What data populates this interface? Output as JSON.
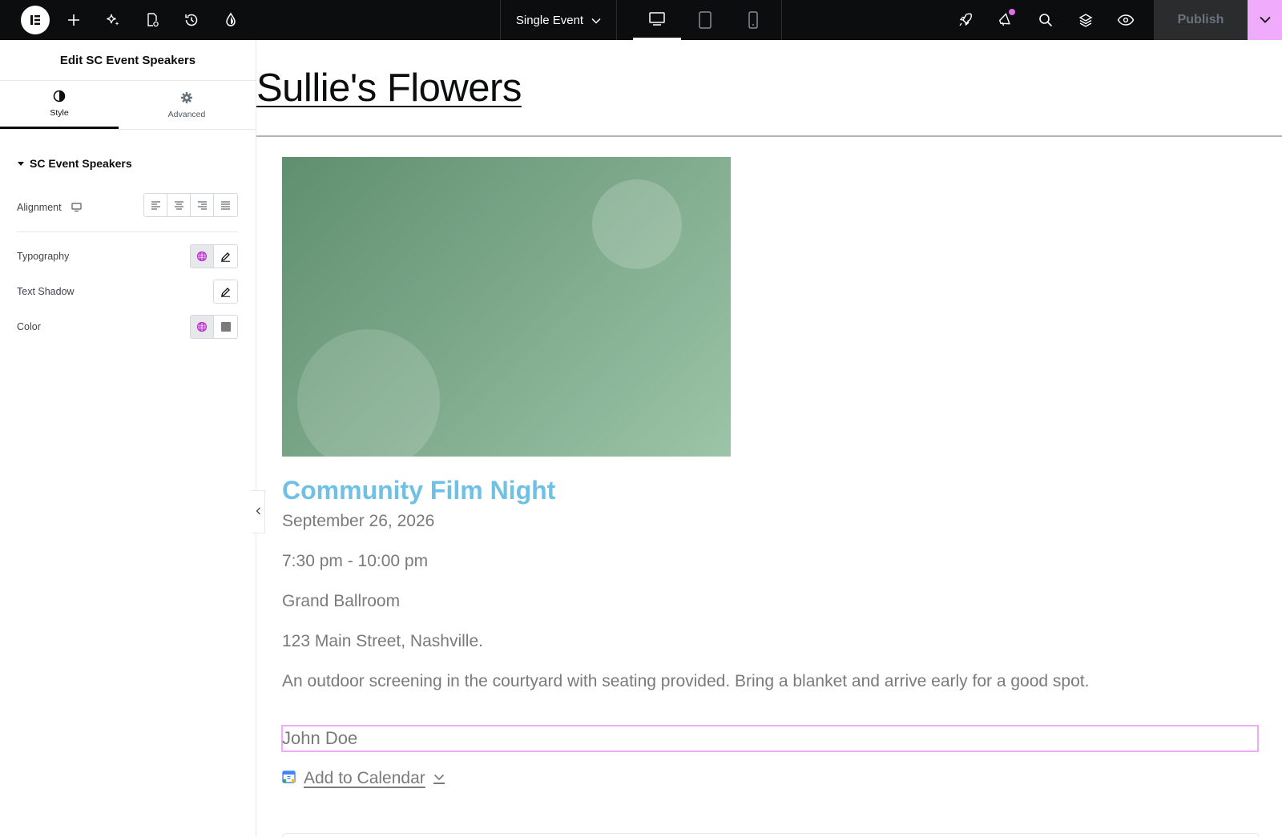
{
  "topbar": {
    "document_title": "Single Event",
    "publish_label": "Publish"
  },
  "panel": {
    "title": "Edit SC Event Speakers",
    "tabs": [
      {
        "label": "Style"
      },
      {
        "label": "Advanced"
      }
    ],
    "section_title": "SC Event Speakers",
    "controls": {
      "alignment": "Alignment",
      "typography": "Typography",
      "text_shadow": "Text Shadow",
      "color": "Color"
    }
  },
  "canvas": {
    "site_title": "Sullie's Flowers",
    "event_title": "Community Film Night",
    "date": "September 26, 2026",
    "time": "7:30 pm - 10:00 pm",
    "venue": "Grand Ballroom",
    "address": "123 Main Street, Nashville.",
    "description": "An outdoor screening in the courtyard with seating provided. Bring a blanket and arrive early for a good spot.",
    "speaker": "John Doe",
    "add_to_calendar": "Add to Calendar"
  },
  "colors": {
    "accent_pink": "#f0abfc",
    "event_title_blue": "#6ec1e4",
    "topbar_bg": "#0c0d0e",
    "text_gray": "#7a7a7a"
  },
  "icons": [
    "elementor-logo-icon",
    "plus-icon",
    "ai-sparkle-icon",
    "page-settings-icon",
    "history-icon",
    "site-settings-icon",
    "chevron-down-icon",
    "desktop-icon",
    "tablet-icon",
    "mobile-icon",
    "rocket-icon",
    "announcement-icon",
    "search-icon",
    "layers-icon",
    "eye-icon",
    "style-contrast-icon",
    "gear-icon",
    "globe-icon",
    "pencil-icon",
    "calendar-icon"
  ]
}
